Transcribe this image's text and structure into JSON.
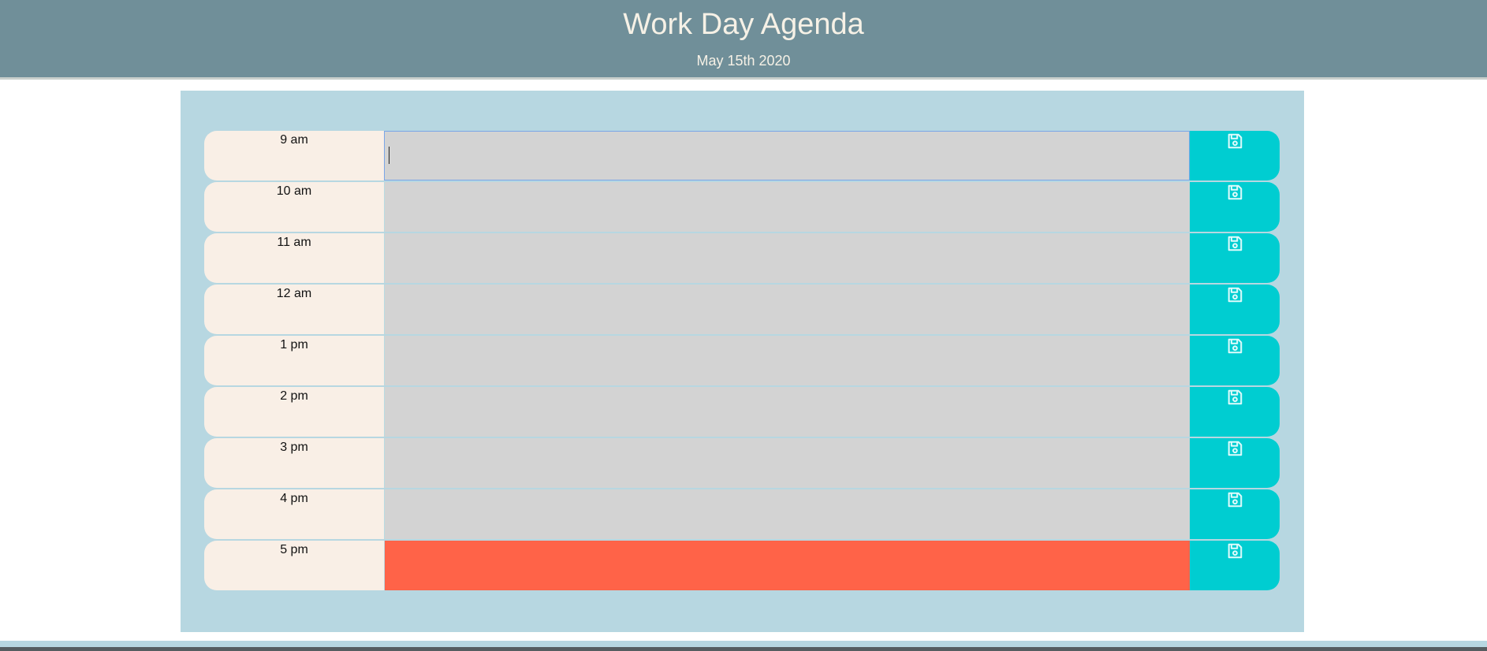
{
  "header": {
    "title": "Work Day Agenda",
    "date": "May 15th 2020"
  },
  "schedule": {
    "rows": [
      {
        "hour": "9 am",
        "value": "",
        "state": "focused"
      },
      {
        "hour": "10 am",
        "value": "",
        "state": "normal"
      },
      {
        "hour": "11 am",
        "value": "",
        "state": "normal"
      },
      {
        "hour": "12 am",
        "value": "",
        "state": "normal"
      },
      {
        "hour": "1 pm",
        "value": "",
        "state": "normal"
      },
      {
        "hour": "2 pm",
        "value": "",
        "state": "normal"
      },
      {
        "hour": "3 pm",
        "value": "",
        "state": "normal"
      },
      {
        "hour": "4 pm",
        "value": "",
        "state": "normal"
      },
      {
        "hour": "5 pm",
        "value": "",
        "state": "present"
      }
    ],
    "save_icon": "floppy-disk-icon"
  },
  "colors": {
    "header_bg": "#708f99",
    "panel_bg": "#b7d7e1",
    "hour_bg": "#f9efe6",
    "task_bg": "#d3d3d3",
    "present_bg": "#ff6348",
    "save_bg": "#00cdd1"
  }
}
